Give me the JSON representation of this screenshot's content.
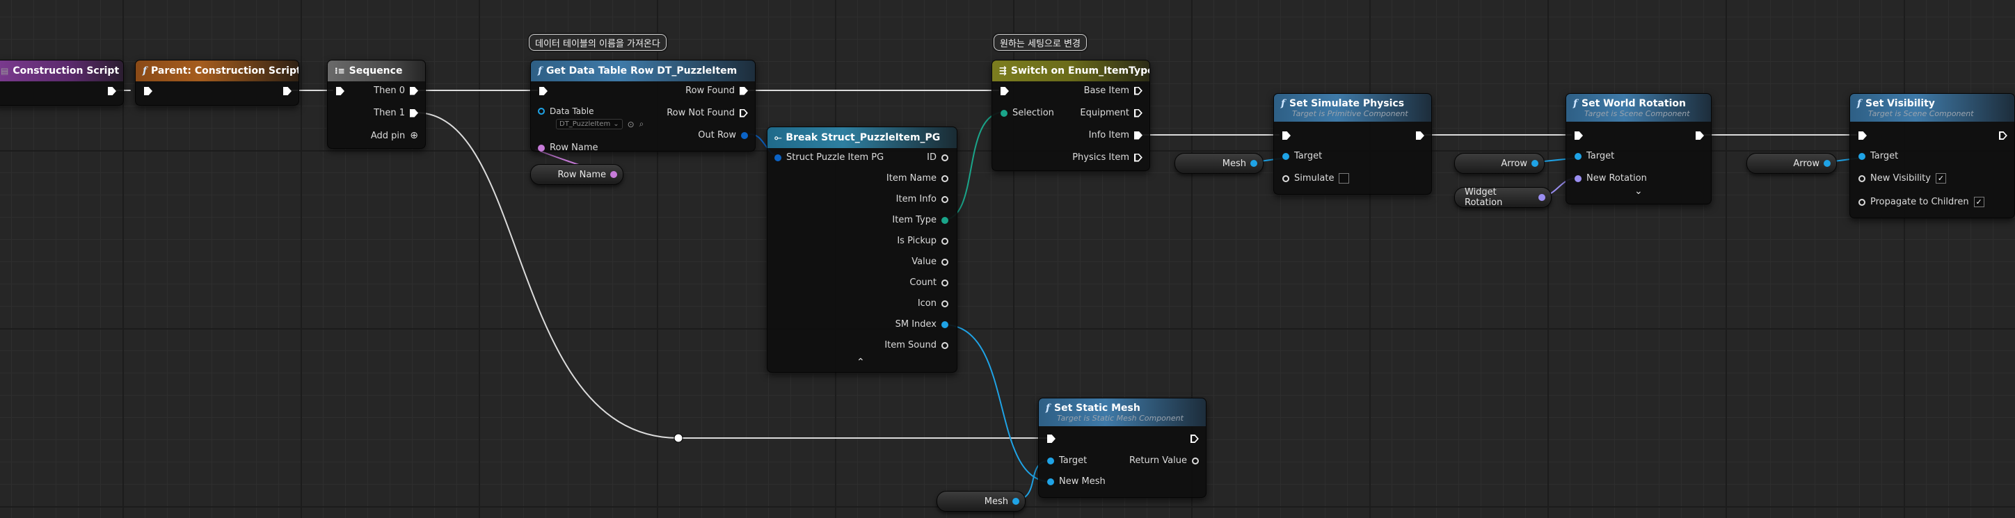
{
  "nodes": {
    "construction_script": {
      "title": "Construction Script"
    },
    "parent_construction_script": {
      "title": "Parent: Construction Script"
    },
    "sequence": {
      "title": "Sequence",
      "then0": "Then 0",
      "then1": "Then 1",
      "add_pin": "Add pin"
    },
    "get_data_table_row": {
      "title": "Get Data Table Row DT_PuzzleItem",
      "row_found": "Row Found",
      "row_not_found": "Row Not Found",
      "data_table_label": "Data Table",
      "data_table_value": "DT_PuzzleItem",
      "row_name": "Row Name",
      "out_row": "Out Row"
    },
    "break_struct": {
      "title": "Break Struct_PuzzleItem_PG",
      "input": "Struct Puzzle Item PG",
      "outputs": [
        "ID",
        "Item Name",
        "Item Info",
        "Item Type",
        "Is Pickup",
        "Value",
        "Count",
        "Icon",
        "SM Index",
        "Item Sound"
      ]
    },
    "switch_enum": {
      "title": "Switch on Enum_ItemType",
      "selection": "Selection",
      "outputs": [
        "Base Item",
        "Equipment",
        "Info Item",
        "Physics Item"
      ]
    },
    "set_simulate_physics": {
      "title": "Set Simulate Physics",
      "subtitle": "Target is Primitive Component",
      "target": "Target",
      "simulate": "Simulate"
    },
    "set_world_rotation": {
      "title": "Set World Rotation",
      "subtitle": "Target is Scene Component",
      "target": "Target",
      "new_rotation": "New Rotation"
    },
    "set_visibility": {
      "title": "Set Visibility",
      "subtitle": "Target is Scene Component",
      "target": "Target",
      "new_visibility": "New Visibility",
      "propagate": "Propagate to Children"
    },
    "set_static_mesh": {
      "title": "Set Static Mesh",
      "subtitle": "Target is Static Mesh Component",
      "target": "Target",
      "return_value": "Return Value",
      "new_mesh": "New Mesh"
    }
  },
  "variables": {
    "row_name": "Row Name",
    "mesh_top": "Mesh",
    "arrow_1": "Arrow",
    "widget_rotation": "Widget Rotation",
    "arrow_2": "Arrow",
    "mesh_bottom": "Mesh"
  },
  "comments": {
    "c1": "데이터 테이블의 이름을 가져온다",
    "c2": "원하는 세팅으로 변경"
  },
  "checkboxes": {
    "simulate": false,
    "new_visibility": true,
    "propagate": true
  },
  "icons": [
    "function-icon",
    "sequence-icon",
    "switch-icon",
    "break-struct-icon",
    "add-pin-icon",
    "expand-chevron-icon",
    "reset-icon",
    "browse-icon"
  ]
}
